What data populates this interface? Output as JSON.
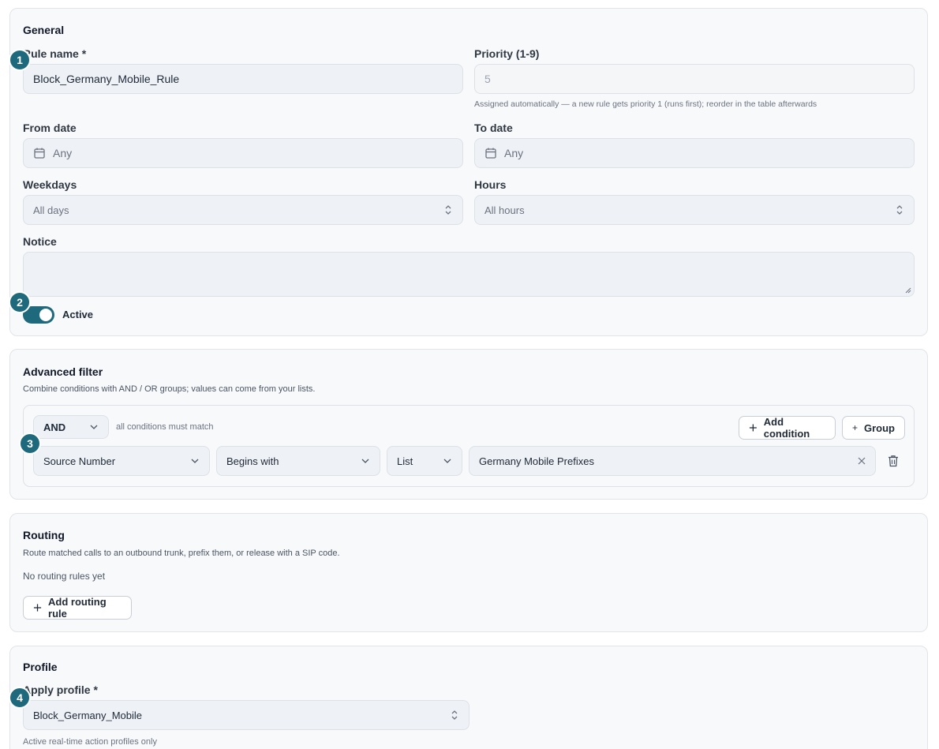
{
  "general": {
    "title": "General",
    "rule_name": {
      "label": "Rule name *",
      "value": "Block_Germany_Mobile_Rule"
    },
    "priority": {
      "label": "Priority (1-9)",
      "placeholder": "5",
      "hint": "Assigned automatically — a new rule gets priority 1 (runs first); reorder in the table afterwards"
    },
    "from_date": {
      "label": "From date",
      "placeholder": "Any"
    },
    "to_date": {
      "label": "To date",
      "placeholder": "Any"
    },
    "weekdays": {
      "label": "Weekdays",
      "value": "All days"
    },
    "hours": {
      "label": "Hours",
      "value": "All hours"
    },
    "notice": {
      "label": "Notice",
      "value": ""
    },
    "active": {
      "label": "Active",
      "on": true
    }
  },
  "advanced_filter": {
    "title": "Advanced filter",
    "description": "Combine conditions with AND / OR groups; values can come from your lists.",
    "operator": "AND",
    "operator_hint": "all conditions must match",
    "add_condition_label": "Add condition",
    "group_label": "Group",
    "condition": {
      "field": "Source Number",
      "comparator": "Begins with",
      "value_type": "List",
      "value": "Germany Mobile Prefixes"
    }
  },
  "routing": {
    "title": "Routing",
    "description": "Route matched calls to an outbound trunk, prefix them, or release with a SIP code.",
    "empty_text": "No routing rules yet",
    "add_label": "Add routing rule"
  },
  "profile": {
    "title": "Profile",
    "apply_label": "Apply profile *",
    "value": "Block_Germany_Mobile",
    "hint": "Active real-time action profiles only"
  },
  "badges": [
    "1",
    "2",
    "3",
    "4"
  ],
  "colors": {
    "accent": "#1e6a7c",
    "card_bg": "#f8f9fb",
    "input_bg": "#eef1f5"
  }
}
